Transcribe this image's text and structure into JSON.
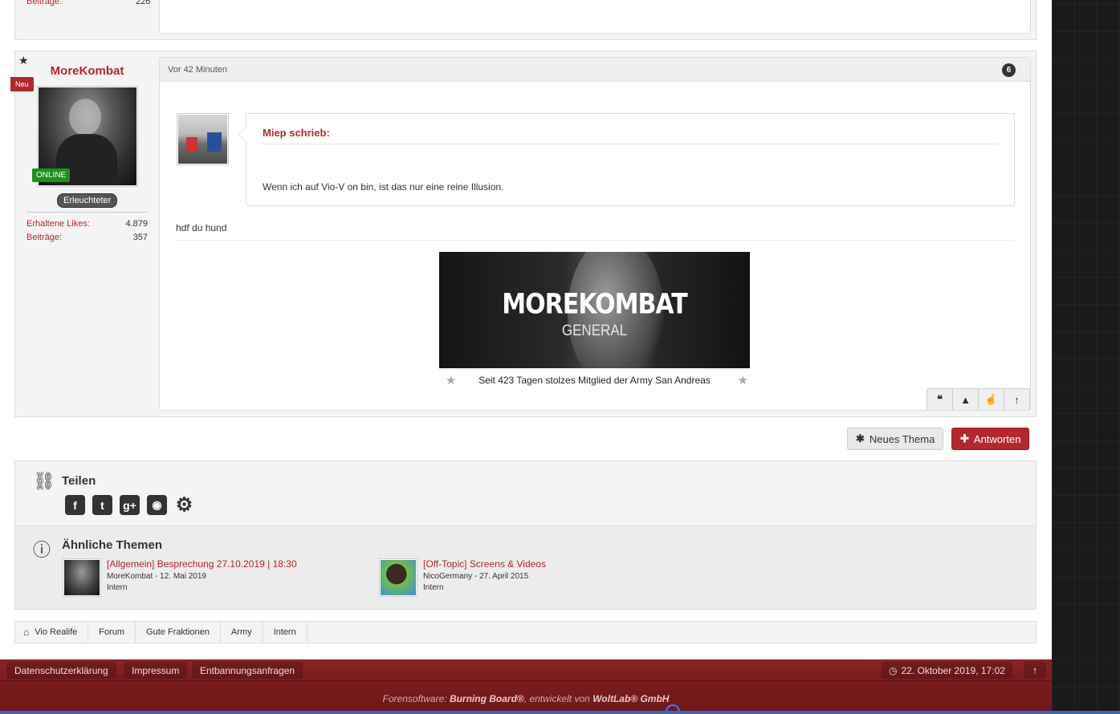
{
  "prev_post": {
    "stat_label": "Beiträge:",
    "stat_value": "226"
  },
  "post": {
    "author": "MoreKombat",
    "new_badge": "Neu",
    "online_badge": "ONLINE",
    "rank": "Erleuchteter",
    "stats": [
      {
        "label": "Erhaltene Likes:",
        "value": "4.879"
      },
      {
        "label": "Beiträge:",
        "value": "357"
      }
    ],
    "time": "Vor 42 Minuten",
    "number": "6",
    "quote": {
      "title": "Miep schrieb:",
      "text": "Wenn ich auf Vio-V on bin, ist das nur eine reine Illusion."
    },
    "text": "hdf du hund",
    "signature": {
      "banner_title": "MOREKOMBAT",
      "banner_sub": "GENERAL",
      "caption": "Seit 423 Tagen stolzes Mitglied der Army San Andreas"
    },
    "actions": [
      "quote-icon",
      "warning-icon",
      "thumbs-up-icon",
      "arrow-up-icon"
    ]
  },
  "buttons": {
    "new_topic": "Neues Thema",
    "reply": "Antworten"
  },
  "share": {
    "title": "Teilen"
  },
  "similar": {
    "title": "Ähnliche Themen",
    "threads": [
      {
        "title": "[Allgemein] Besprechung 27.10.2019 | 18:30",
        "meta": "MoreKombat - 12. Mai 2019",
        "category": "Intern"
      },
      {
        "title": "[Off-Topic] Screens & Videos",
        "meta": "NicoGermany - 27. April 2015",
        "category": "Intern"
      }
    ]
  },
  "breadcrumb": [
    "Vio Realife",
    "Forum",
    "Gute Fraktionen",
    "Army",
    "Intern"
  ],
  "footer": {
    "links": [
      "Datenschutzerklärung",
      "Impressum",
      "Entbannungsanfragen"
    ],
    "date": "22. Oktober 2019, 17:02",
    "copyright_prefix": "Forensoftware:",
    "copyright_product": "Burning Board®",
    "copyright_mid": ", entwickelt von",
    "copyright_company": "WoltLab® GmbH"
  },
  "colors": {
    "accent": "#b3282d",
    "footer": "#7a1c1e",
    "online": "#1f8f1f"
  }
}
